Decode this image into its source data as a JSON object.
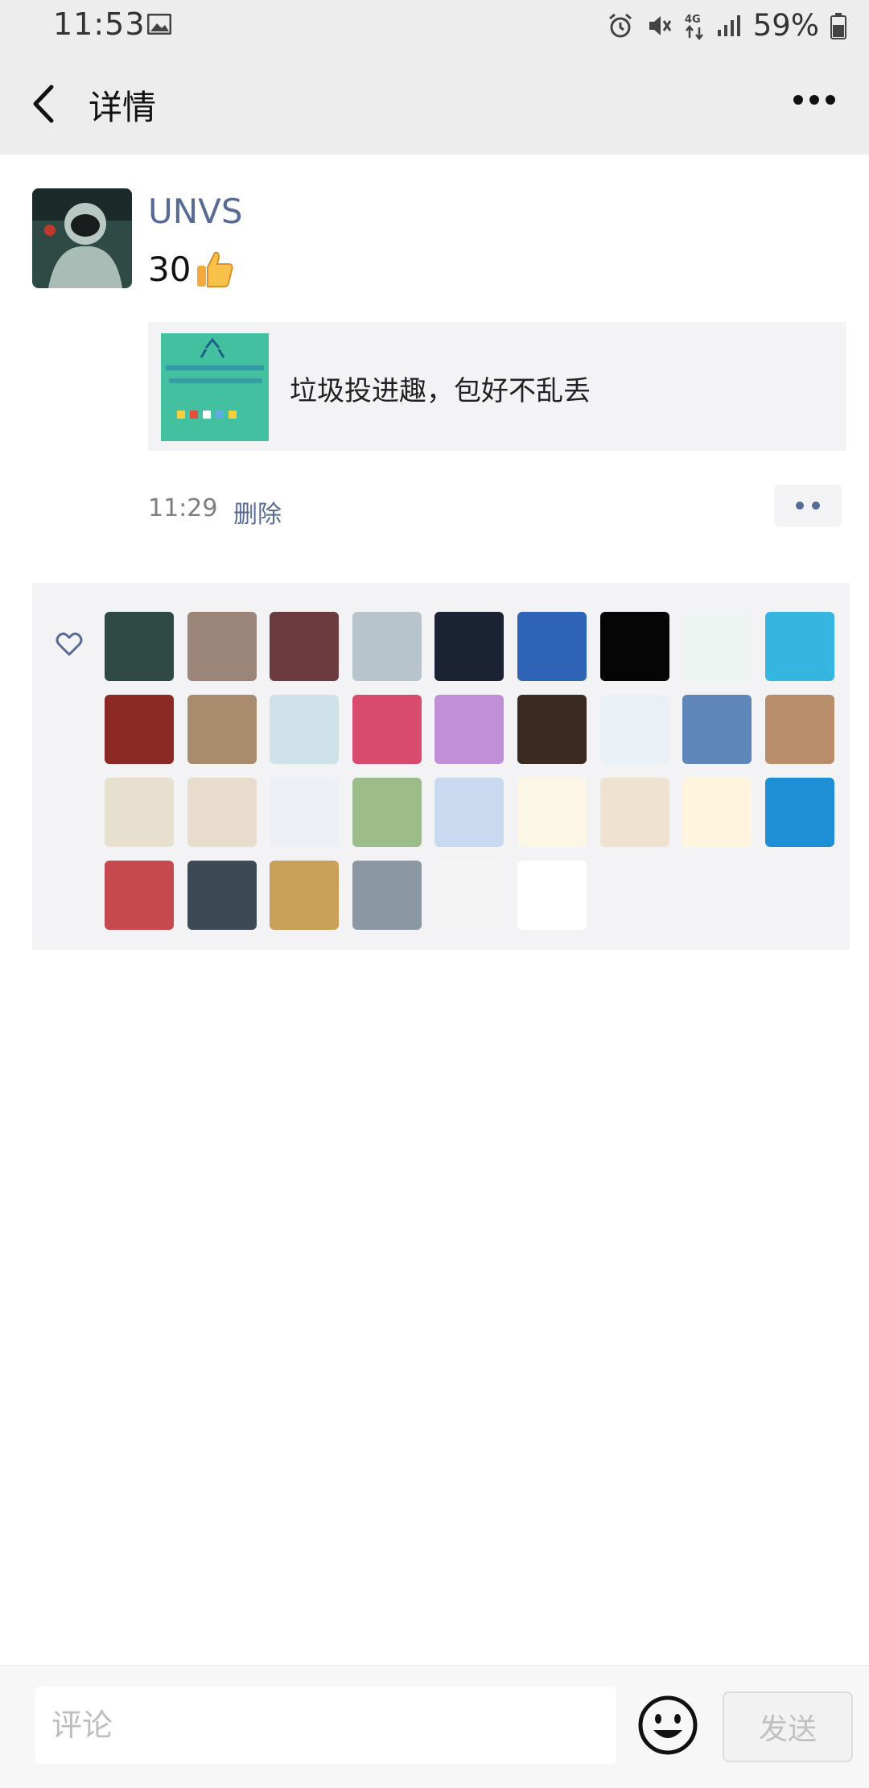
{
  "status_bar": {
    "time": "11:53",
    "battery_percent": "59%",
    "icons": [
      "image-icon",
      "alarm-icon",
      "mute-icon",
      "4g-icon",
      "signal-icon",
      "battery-icon"
    ]
  },
  "nav": {
    "title": "详情",
    "back_icon": "back-arrow-icon",
    "more_icon": "more-dots-icon"
  },
  "post": {
    "username": "UNVS",
    "text": "30",
    "emoji": "thumbs-up",
    "link_title": "垃圾投进趣，包好不乱丢",
    "time": "11:29",
    "delete_label": "删除"
  },
  "likes": {
    "icon": "heart-icon",
    "avatars": [
      "#2f4a45",
      "#9b8578",
      "#6b3b40",
      "#b7c4cc",
      "#1a2233",
      "#2f63b5",
      "#050505",
      "#eef4f2",
      "#35b6e0",
      "#8b2a24",
      "#a98b6e",
      "#cfe2ea",
      "#d94b6e",
      "#c18ed8",
      "#3a2a22",
      "#e9f1f7",
      "#5f86b9",
      "#b78d6a",
      "#e7e0cf",
      "#e8dccd",
      "#eef0f7",
      "#9cbc8a",
      "#c9d9ef",
      "#fbf6e5",
      "#efe2d0",
      "#fff4de",
      "#1e8fd5",
      "#c64a4d",
      "#3d4a55",
      "#c8a058",
      "#8b97a2",
      "#f4f4f4",
      "#ffffff"
    ]
  },
  "comment_bar": {
    "placeholder": "评论",
    "send_label": "发送",
    "emoji_icon": "smiley-icon"
  }
}
